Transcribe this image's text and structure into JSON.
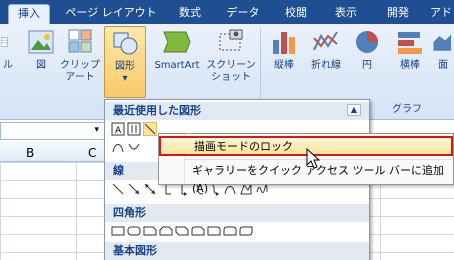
{
  "tabs": [
    {
      "label": "挿入",
      "active": true
    },
    {
      "label": "ページ レイアウト",
      "active": false
    },
    {
      "label": "数式",
      "active": false
    },
    {
      "label": "データ",
      "active": false
    },
    {
      "label": "校閲",
      "active": false
    },
    {
      "label": "表示",
      "active": false
    },
    {
      "label": "開発",
      "active": false
    },
    {
      "label": "アド",
      "active": false
    }
  ],
  "ribbon": {
    "partial_left": "ル",
    "picture": "図",
    "clipart_line1": "クリップ",
    "clipart_line2": "アート",
    "shapes": "図形",
    "smartart": "SmartArt",
    "screenshot_line1": "スクリーン",
    "screenshot_line2": "ショット",
    "column": "縦棒",
    "line": "折れ線",
    "pie": "円",
    "bar": "横棒",
    "area_partial": "面",
    "group_graph": "グラフ",
    "dropdown_arrow": "▾"
  },
  "sheet": {
    "col_b": "B",
    "col_c": "C"
  },
  "gallery": {
    "recent_title": "最近使用した図形",
    "lines_title": "線",
    "rect_title": "四角形",
    "basic_title": "基本図形",
    "scroll_up": "▲",
    "scroll_down": "▼"
  },
  "context_menu": {
    "lock_drawing_mode": "描画モードのロック",
    "add_to_qat": "ギャラリーをクイック アクセス ツール バーに追加(A)"
  },
  "colors": {
    "tab_bar": "#1f4e93",
    "highlight_border": "#d01919",
    "selected_button": "#f8c969"
  }
}
